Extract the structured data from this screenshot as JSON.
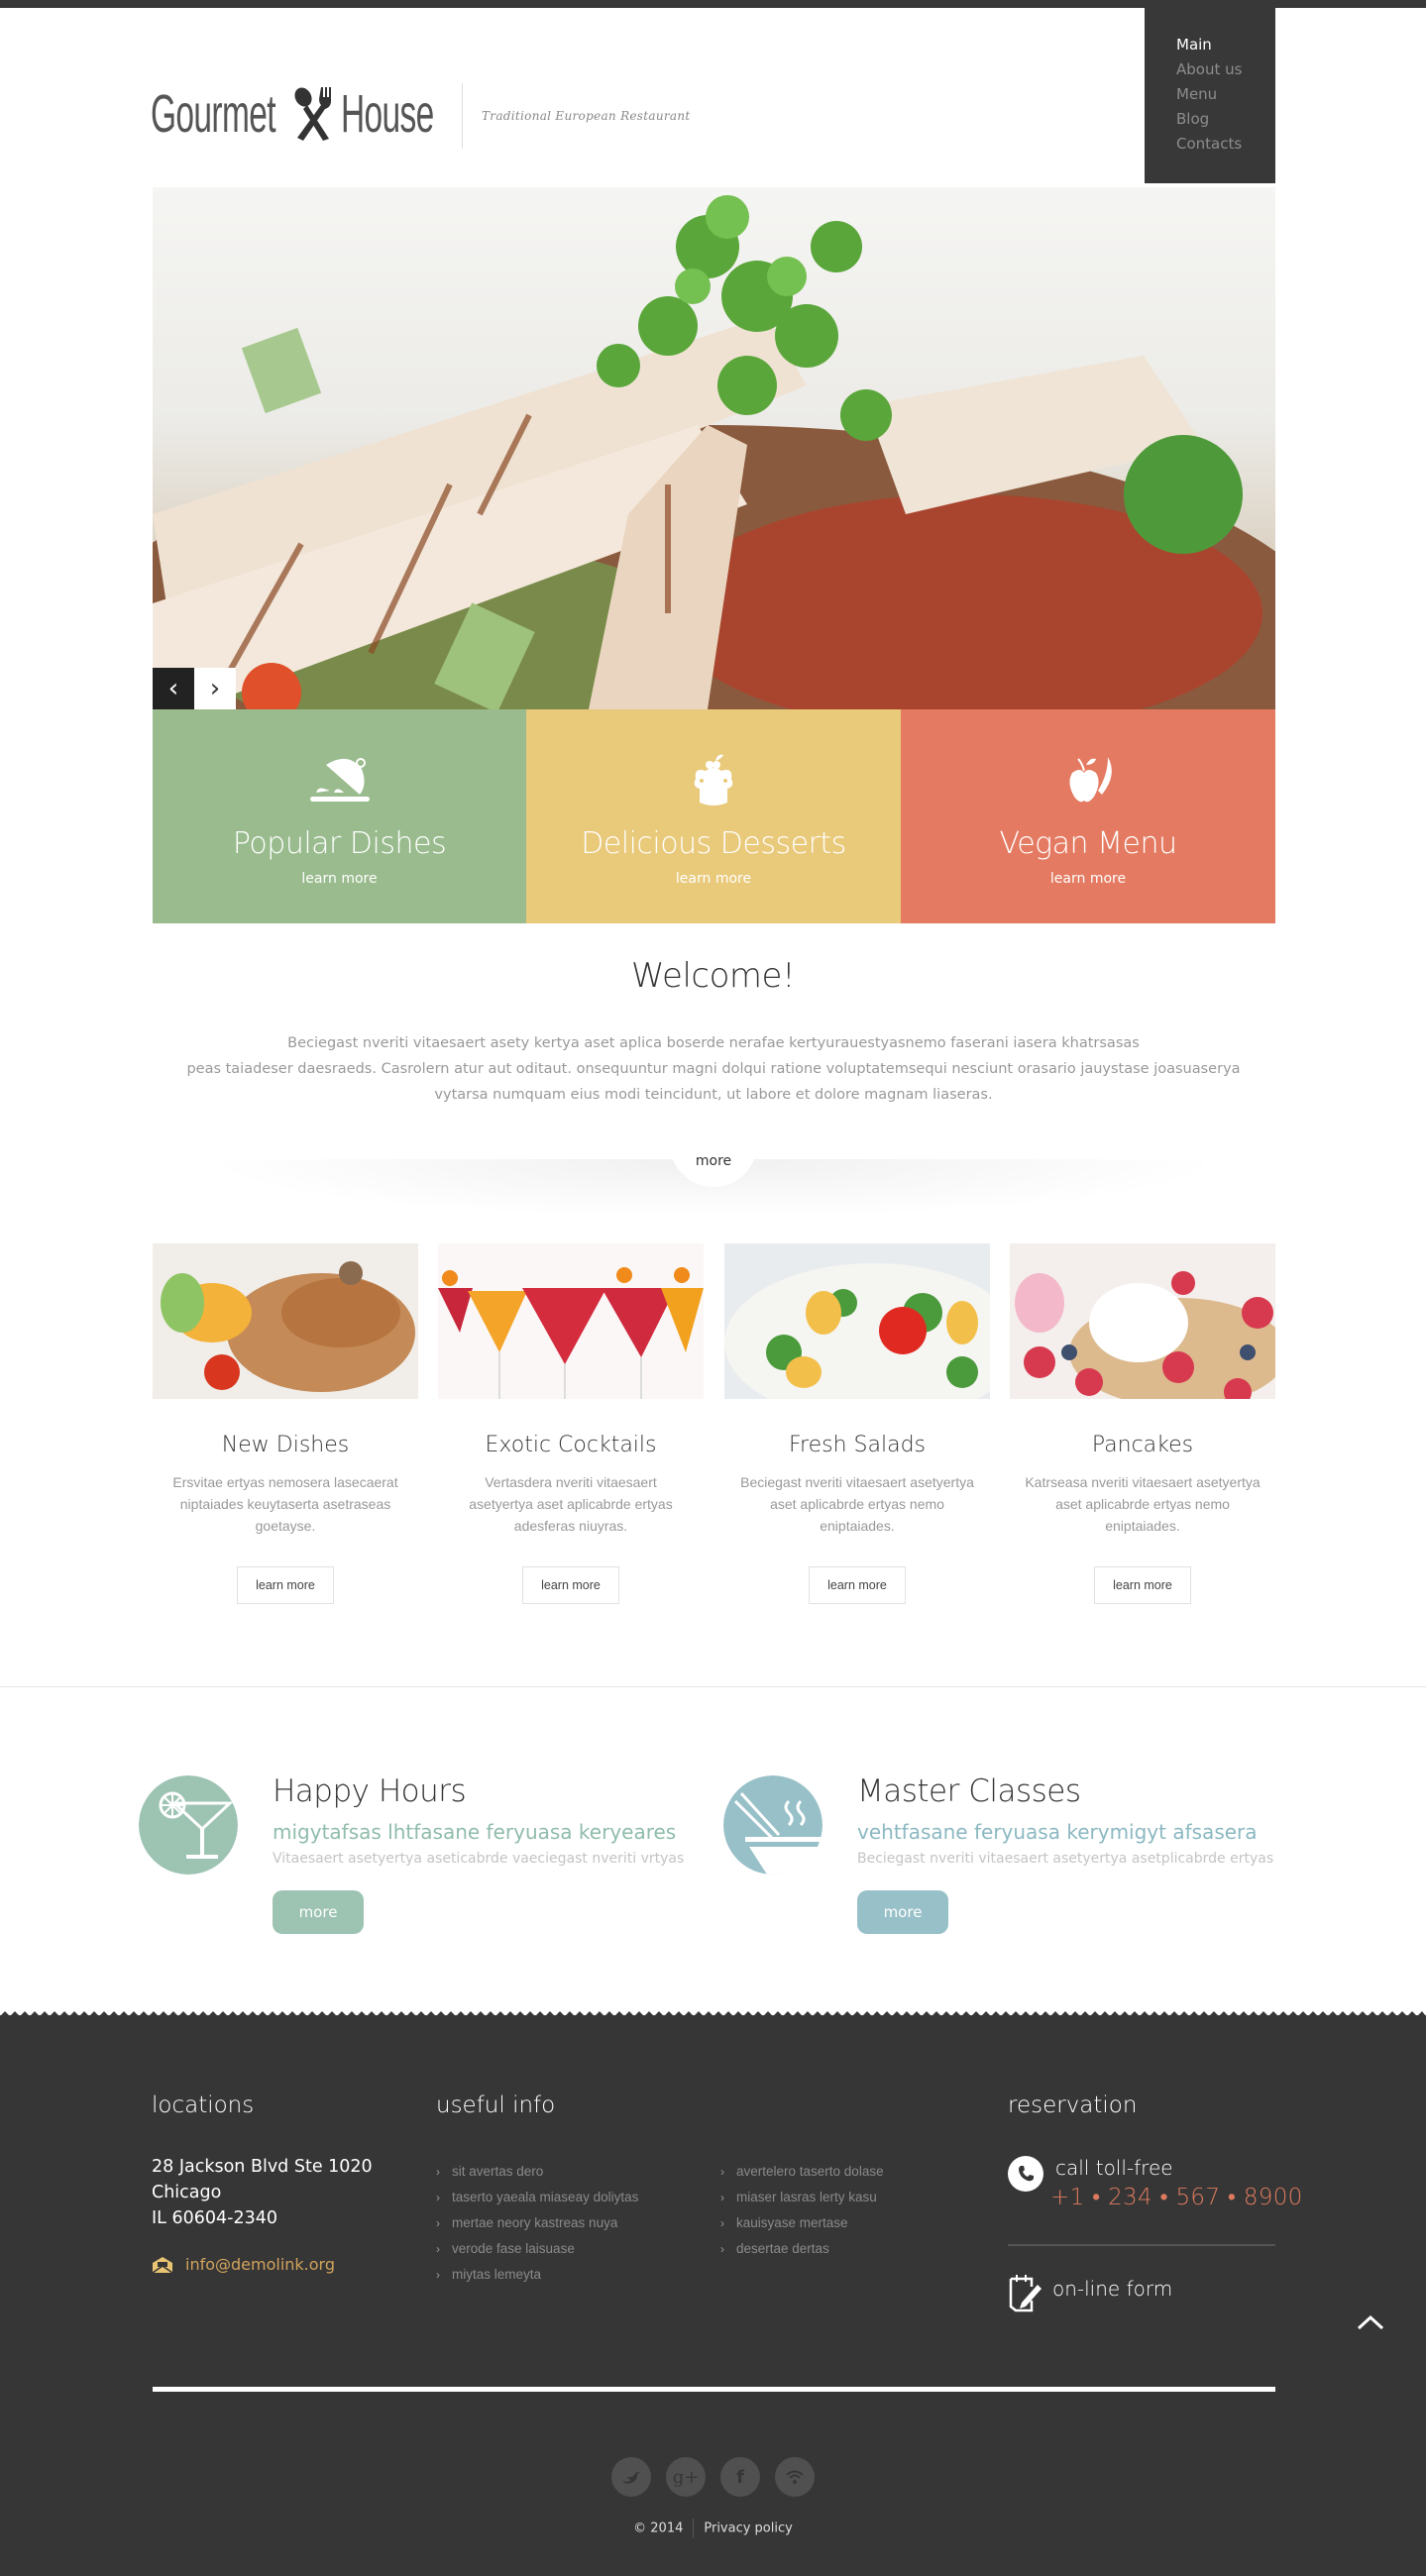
{
  "brand": {
    "name_part1": "Gourmet",
    "name_part2": "House",
    "tagline": "Traditional European Restaurant"
  },
  "nav": {
    "items": [
      {
        "label": "Main",
        "active": true
      },
      {
        "label": "About us",
        "active": false
      },
      {
        "label": "Menu",
        "active": false
      },
      {
        "label": "Blog",
        "active": false
      },
      {
        "label": "Contacts",
        "active": false
      }
    ]
  },
  "slider": {
    "prev_icon": "chevron-left-icon",
    "next_icon": "chevron-right-icon",
    "prev_glyph": "‹",
    "next_glyph": "›"
  },
  "tiles": [
    {
      "title": "Popular Dishes",
      "link": "learn more",
      "icon": "cloche-icon",
      "color": "#99bb8d"
    },
    {
      "title": "Delicious Desserts",
      "link": "learn more",
      "icon": "cake-icon",
      "color": "#e9c97a"
    },
    {
      "title": "Vegan Menu",
      "link": "learn more",
      "icon": "apple-icon",
      "color": "#e47a61"
    }
  ],
  "welcome": {
    "title": "Welcome!",
    "text_lines": [
      "Beciegast nveriti vitaesaert asety kertya aset aplica boserde nerafae kertyurauestyasnemo faserani  iasera khatrsasas",
      "peas taiadeser daesraeds. Casrolern atur aut oditaut. onsequuntur magni dolqui ratione voluptatemsequi nesciunt orasario jauystase joasuaserya",
      "vytarsa numquam eius modi teincidunt, ut labore et dolore magnam liaseras."
    ],
    "more_label": "more"
  },
  "cards": [
    {
      "title": "New Dishes",
      "text": "Ersvitae ertyas nemosera lasecaerat niptaiades keuytaserta asetraseas goetayse.",
      "button": "learn more"
    },
    {
      "title": "Exotic Cocktails",
      "text": "Vertasdera nveriti vitaesaert asetyertya aset aplicabrde ertyas adesferas niuyras.",
      "button": "learn more"
    },
    {
      "title": "Fresh Salads",
      "text": "Beciegast nveriti vitaesaert asetyertya aset aplicabrde ertyas nemo eniptaiades.",
      "button": "learn more"
    },
    {
      "title": "Pancakes",
      "text": "Katrseasa nveriti vitaesaert asetyertya aset aplicabrde ertyas nemo eniptaiades.",
      "button": "learn more"
    }
  ],
  "features": [
    {
      "title": "Happy Hours",
      "subtitle": "migytafsas lhtfasane feryuasa keryeares",
      "desc": "Vitaesaert asetyertya aseticabrde vaeciegast nveriti vrtyas",
      "button": "more",
      "icon": "cocktail-icon",
      "color": "#9dc3b3"
    },
    {
      "title": "Master Classes",
      "subtitle": "vehtfasane feryuasa kerymigyt afsasera",
      "desc": "Beciegast nveriti vitaesaert asetyertya asetplicabrde ertyas",
      "button": "more",
      "icon": "bowl-chopsticks-icon",
      "color": "#98c0c8"
    }
  ],
  "footer": {
    "locations": {
      "title": "locations",
      "address_lines": [
        "28 Jackson Blvd Ste 1020",
        "Chicago",
        "IL 60604-2340"
      ],
      "email": "info@demolink.org"
    },
    "useful_info": {
      "title": "useful info",
      "col1": [
        "sit avertas dero",
        "taserto yaeala miaseay doliytas",
        "mertae neory kastreas nuya",
        "verode fase laisuase",
        "miytas lemeyta"
      ],
      "col2": [
        "avertelero taserto dolase",
        "miaser lasras lerty kasu",
        "kauisyase mertase",
        "desertae dertas"
      ]
    },
    "reservation": {
      "title": "reservation",
      "call_label": "call toll-free",
      "phone": "+1 • 234 • 567 • 8900",
      "form_label": "on-line form"
    },
    "socials": [
      {
        "name": "twitter-icon",
        "glyph": "t"
      },
      {
        "name": "google-plus-icon",
        "glyph": "g+"
      },
      {
        "name": "facebook-icon",
        "glyph": "f"
      },
      {
        "name": "rss-icon",
        "glyph": "≈"
      }
    ],
    "copyright": "© 2014",
    "privacy": "Privacy policy"
  }
}
